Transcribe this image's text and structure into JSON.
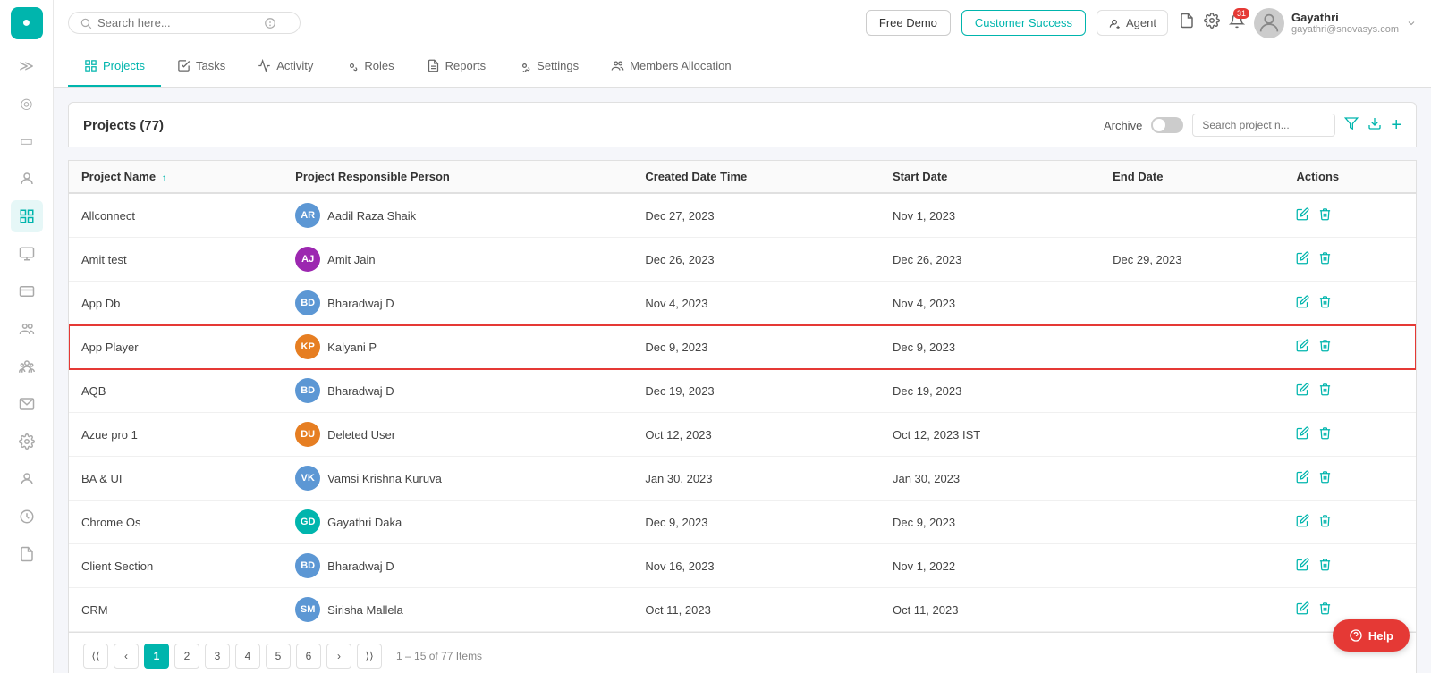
{
  "app": {
    "logo": "●",
    "logo_bg": "#00b5ad"
  },
  "topbar": {
    "search_placeholder": "Search here...",
    "free_demo_label": "Free Demo",
    "customer_success_label": "Customer Success",
    "agent_label": "Agent",
    "notification_count": "31",
    "user_name": "Gayathri",
    "user_email": "gayathri@snovasys.com"
  },
  "nav": {
    "tabs": [
      {
        "id": "projects",
        "label": "Projects",
        "icon": "📋",
        "active": true
      },
      {
        "id": "tasks",
        "label": "Tasks",
        "icon": "☑"
      },
      {
        "id": "activity",
        "label": "Activity",
        "icon": "📊"
      },
      {
        "id": "roles",
        "label": "Roles",
        "icon": "⚙"
      },
      {
        "id": "reports",
        "label": "Reports",
        "icon": "📄"
      },
      {
        "id": "settings",
        "label": "Settings",
        "icon": "⚙"
      },
      {
        "id": "members",
        "label": "Members Allocation",
        "icon": "👥"
      }
    ]
  },
  "projects_section": {
    "title": "Projects (77)",
    "archive_label": "Archive",
    "search_placeholder": "Search project n..."
  },
  "table": {
    "columns": [
      "Project Name",
      "Project Responsible Person",
      "Created Date Time",
      "Start Date",
      "End Date",
      "Actions"
    ],
    "rows": [
      {
        "id": 1,
        "project": "Allconnect",
        "person": "Aadil Raza Shaik",
        "avatar_color": "#5c97d4",
        "avatar_text": "AR",
        "created": "Dec 27, 2023",
        "start": "Nov 1, 2023",
        "end": "",
        "highlighted": false
      },
      {
        "id": 2,
        "project": "Amit test",
        "person": "Amit Jain",
        "avatar_color": "#9c27b0",
        "avatar_text": "AJ",
        "created": "Dec 26, 2023",
        "start": "Dec 26, 2023",
        "end": "Dec 29, 2023",
        "highlighted": false
      },
      {
        "id": 3,
        "project": "App Db",
        "person": "Bharadwaj D",
        "avatar_color": "#5c97d4",
        "avatar_text": "BD",
        "created": "Nov 4, 2023",
        "start": "Nov 4, 2023",
        "end": "",
        "highlighted": false
      },
      {
        "id": 4,
        "project": "App Player",
        "person": "Kalyani P",
        "avatar_color": "#e67e22",
        "avatar_text": "KP",
        "created": "Dec 9, 2023",
        "start": "Dec 9, 2023",
        "end": "",
        "highlighted": true
      },
      {
        "id": 5,
        "project": "AQB",
        "person": "Bharadwaj D",
        "avatar_color": "#5c97d4",
        "avatar_text": "BD",
        "created": "Dec 19, 2023",
        "start": "Dec 19, 2023",
        "end": "",
        "highlighted": false
      },
      {
        "id": 6,
        "project": "Azue pro 1",
        "person": "Deleted User",
        "avatar_color": "#e67e22",
        "avatar_text": "DU",
        "created": "Oct 12, 2023",
        "start": "Oct 12, 2023 IST",
        "end": "",
        "highlighted": false
      },
      {
        "id": 7,
        "project": "BA & UI",
        "person": "Vamsi Krishna Kuruva",
        "avatar_color": "#5c97d4",
        "avatar_text": "VK",
        "created": "Jan 30, 2023",
        "start": "Jan 30, 2023",
        "end": "",
        "highlighted": false
      },
      {
        "id": 8,
        "project": "Chrome Os",
        "person": "Gayathri Daka",
        "avatar_color": "#00b5ad",
        "avatar_text": "GD",
        "created": "Dec 9, 2023",
        "start": "Dec 9, 2023",
        "end": "",
        "highlighted": false
      },
      {
        "id": 9,
        "project": "Client Section",
        "person": "Bharadwaj D",
        "avatar_color": "#5c97d4",
        "avatar_text": "BD",
        "created": "Nov 16, 2023",
        "start": "Nov 1, 2022",
        "end": "",
        "highlighted": false
      },
      {
        "id": 10,
        "project": "CRM",
        "person": "Sirisha Mallela",
        "avatar_color": "#5c97d4",
        "avatar_text": "SM",
        "created": "Oct 11, 2023",
        "start": "Oct 11, 2023",
        "end": "",
        "highlighted": false
      }
    ]
  },
  "pagination": {
    "current_page": 1,
    "pages": [
      1,
      2,
      3,
      4,
      5,
      6
    ],
    "info": "1 – 15 of 77 Items"
  },
  "help": {
    "label": "Help"
  },
  "sidebar_icons": [
    "≫",
    "◎",
    "▭",
    "👤",
    "📋",
    "▭",
    "💳",
    "👤",
    "👥",
    "✉",
    "⚙",
    "👤",
    "🕐",
    "📄"
  ]
}
